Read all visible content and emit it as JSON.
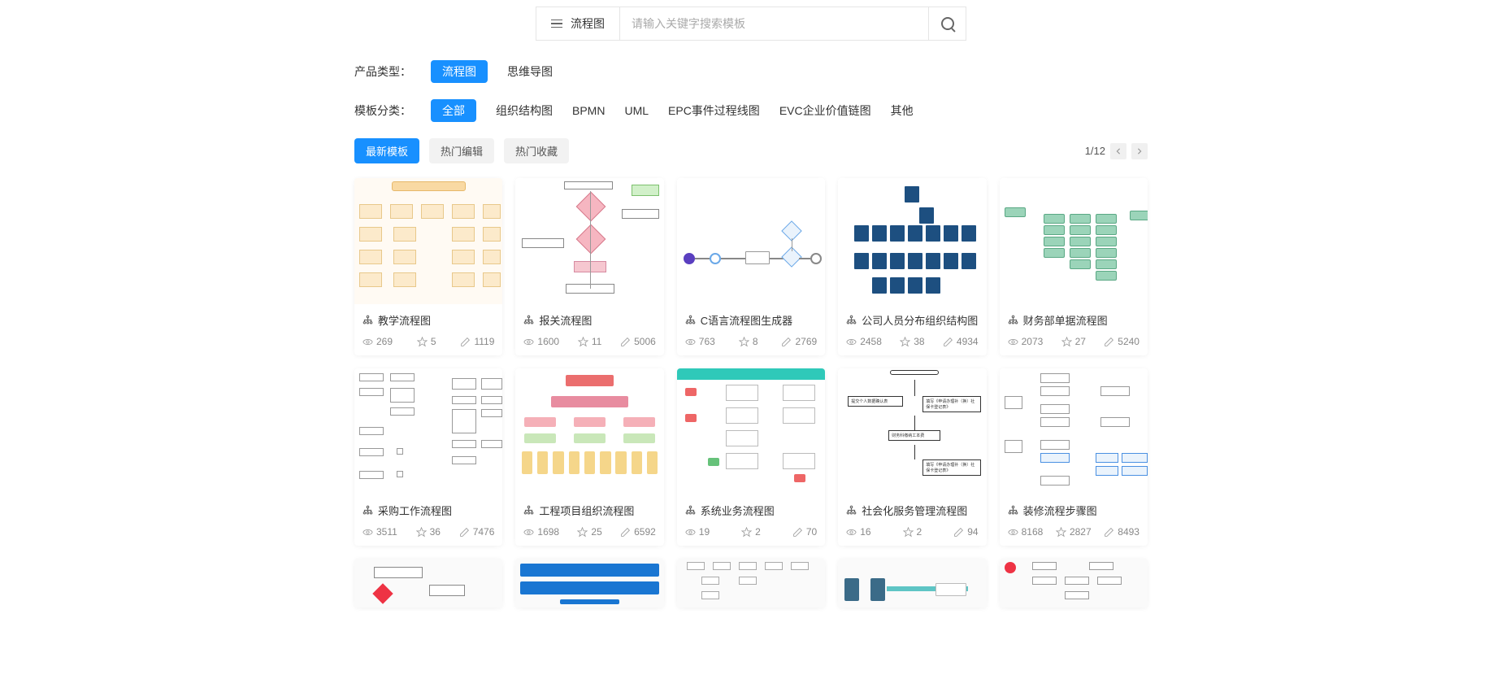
{
  "search": {
    "category_label": "流程图",
    "placeholder": "请输入关键字搜索模板"
  },
  "filter_product": {
    "label": "产品类型：",
    "options": [
      {
        "text": "流程图",
        "active": true
      },
      {
        "text": "思维导图",
        "active": false
      }
    ]
  },
  "filter_category": {
    "label": "模板分类：",
    "options": [
      {
        "text": "全部",
        "active": true
      },
      {
        "text": "组织结构图",
        "active": false
      },
      {
        "text": "BPMN",
        "active": false
      },
      {
        "text": "UML",
        "active": false
      },
      {
        "text": "EPC事件过程线图",
        "active": false
      },
      {
        "text": "EVC企业价值链图",
        "active": false
      },
      {
        "text": "其他",
        "active": false
      }
    ]
  },
  "sort_tabs": [
    {
      "text": "最新模板",
      "active": true
    },
    {
      "text": "热门编辑",
      "active": false
    },
    {
      "text": "热门收藏",
      "active": false
    }
  ],
  "pagination": {
    "text": "1/12"
  },
  "cards": [
    {
      "title": "教学流程图",
      "views": "269",
      "favs": "5",
      "uses": "1119"
    },
    {
      "title": "报关流程图",
      "views": "1600",
      "favs": "11",
      "uses": "5006"
    },
    {
      "title": "C语言流程图生成器",
      "views": "763",
      "favs": "8",
      "uses": "2769"
    },
    {
      "title": "公司人员分布组织结构图",
      "views": "2458",
      "favs": "38",
      "uses": "4934"
    },
    {
      "title": "财务部单据流程图",
      "views": "2073",
      "favs": "27",
      "uses": "5240"
    },
    {
      "title": "采购工作流程图",
      "views": "3511",
      "favs": "36",
      "uses": "7476"
    },
    {
      "title": "工程项目组织流程图",
      "views": "1698",
      "favs": "25",
      "uses": "6592"
    },
    {
      "title": "系统业务流程图",
      "views": "19",
      "favs": "2",
      "uses": "70"
    },
    {
      "title": "社会化服务管理流程图",
      "views": "16",
      "favs": "2",
      "uses": "94"
    },
    {
      "title": "装修流程步骤图",
      "views": "8168",
      "favs": "2827",
      "uses": "8493"
    }
  ]
}
